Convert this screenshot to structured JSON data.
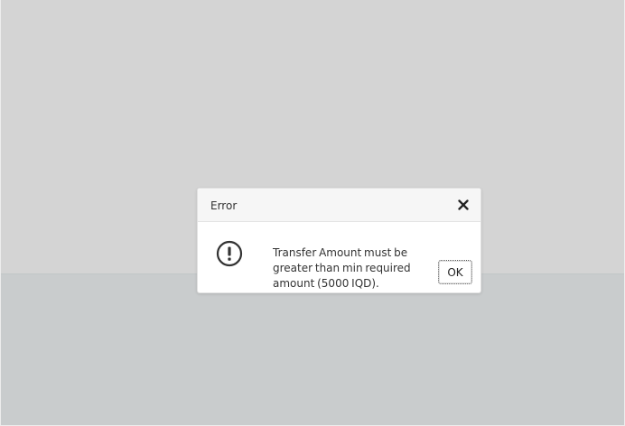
{
  "dialog": {
    "title": "Error",
    "message": "Transfer Amount must be greater than min required amount (5000 IQD).",
    "ok_label": "OK"
  },
  "icons": {
    "close": "close-icon",
    "status": "exclamation-circle-icon"
  },
  "colors": {
    "backdrop_top": "#d4d4d4",
    "backdrop_bottom": "#c9cccd",
    "dialog_header": "#f6f6f6",
    "text": "#333333"
  }
}
